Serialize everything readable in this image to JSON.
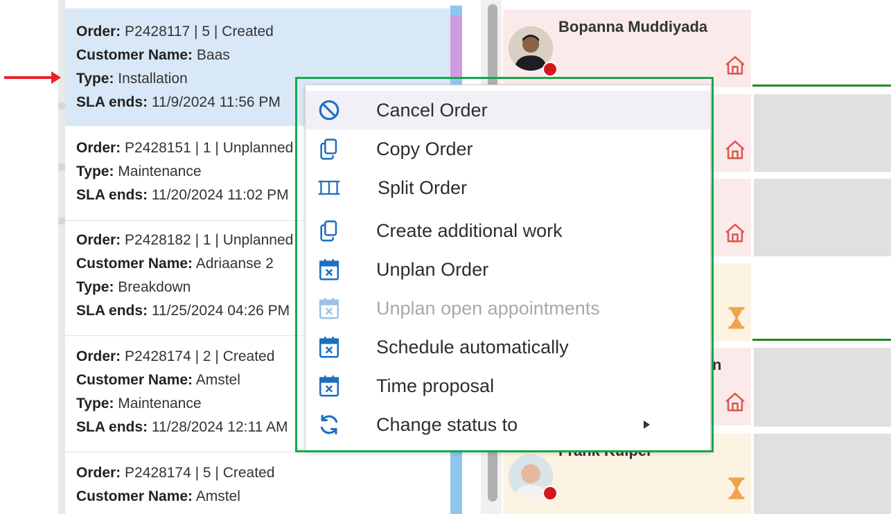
{
  "orders": [
    {
      "lines": [
        {
          "label": "Order:",
          "value": " P2428117 | 5 | Created"
        },
        {
          "label": "Customer Name:",
          "value": " Baas"
        },
        {
          "label": "Type:",
          "value": " Installation"
        },
        {
          "label": "SLA ends:",
          "value": " 11/9/2024 11:56 PM"
        }
      ]
    },
    {
      "lines": [
        {
          "label": "Order:",
          "value": " P2428151 | 1 | Unplanned"
        },
        {
          "label": "Type:",
          "value": " Maintenance"
        },
        {
          "label": "SLA ends:",
          "value": " 11/20/2024 11:02 PM"
        }
      ]
    },
    {
      "lines": [
        {
          "label": "Order:",
          "value": " P2428182 | 1 | Unplanned"
        },
        {
          "label": "Customer Name:",
          "value": " Adriaanse 2"
        },
        {
          "label": "Type:",
          "value": " Breakdown"
        },
        {
          "label": "SLA ends:",
          "value": " 11/25/2024 04:26 PM"
        }
      ]
    },
    {
      "lines": [
        {
          "label": "Order:",
          "value": " P2428174 | 2 | Created"
        },
        {
          "label": "Customer Name:",
          "value": " Amstel"
        },
        {
          "label": "Type:",
          "value": " Maintenance"
        },
        {
          "label": "SLA ends:",
          "value": " 11/28/2024 12:11 AM"
        }
      ]
    },
    {
      "lines": [
        {
          "label": "Order:",
          "value": " P2428174 | 5 | Created"
        },
        {
          "label": "Customer Name:",
          "value": " Amstel"
        }
      ]
    }
  ],
  "resources": {
    "first_name": "Bopanna Muddiyada",
    "partial_char": "n",
    "last_name": "Frank Kuiper",
    "home_icon": "home-icon",
    "pending_icon": "hourglass-icon"
  },
  "context_menu": {
    "items": [
      {
        "label": "Cancel Order",
        "icon": "cancel-icon"
      },
      {
        "label": "Copy Order",
        "icon": "copy-icon"
      },
      {
        "label": "Split Order",
        "icon": "split-icon"
      },
      {
        "label": "Create additional work",
        "icon": "copy-icon"
      },
      {
        "label": "Unplan Order",
        "icon": "calendar-x-icon"
      },
      {
        "label": "Unplan open appointments",
        "icon": "calendar-x-icon",
        "disabled": true
      },
      {
        "label": "Schedule automatically",
        "icon": "calendar-x-icon"
      },
      {
        "label": "Time proposal",
        "icon": "calendar-x-icon"
      },
      {
        "label": "Change status to",
        "icon": "refresh-icon",
        "submenu": true
      }
    ]
  },
  "colors": {
    "accent_blue": "#1e6fbf",
    "selected_row": "#d9e8f6",
    "highlight_border": "#13a84a",
    "pointer_arrow": "#e8232a",
    "status_dot": "#d6151f"
  }
}
